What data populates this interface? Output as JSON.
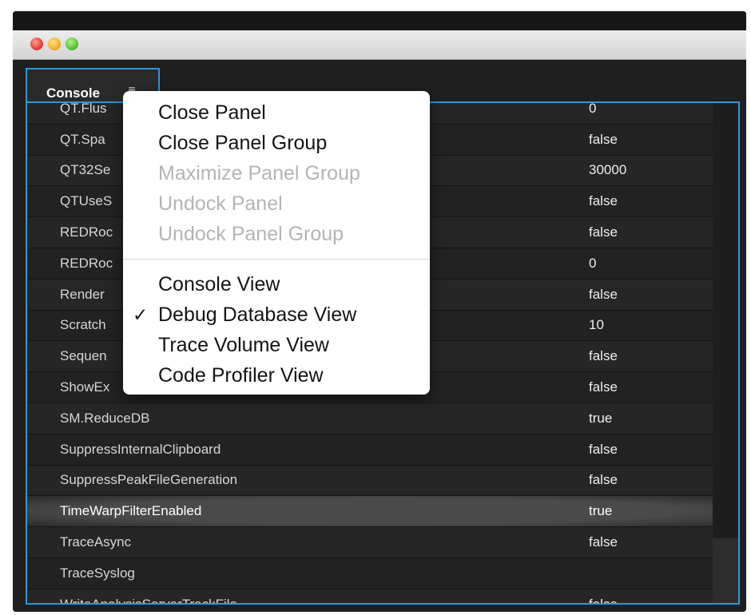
{
  "window": {
    "controls": [
      "close",
      "minimize",
      "maximize"
    ]
  },
  "tab": {
    "label": "Console",
    "menu_icon": "≡"
  },
  "rows": [
    {
      "name": "QT.Flus",
      "value": "0"
    },
    {
      "name": "QT.Spa",
      "value": "false"
    },
    {
      "name": "QT32Se",
      "value": "30000"
    },
    {
      "name": "QTUseS",
      "value": "false"
    },
    {
      "name": "REDRoc",
      "value": "false"
    },
    {
      "name": "REDRoc",
      "value": "0"
    },
    {
      "name": "Render",
      "value": "false"
    },
    {
      "name": "Scratch",
      "value": "10"
    },
    {
      "name": "Sequen",
      "value": "false"
    },
    {
      "name": "ShowEx",
      "value": "false"
    },
    {
      "name": "SM.ReduceDB",
      "value": "true"
    },
    {
      "name": "SuppressInternalClipboard",
      "value": "false"
    },
    {
      "name": "SuppressPeakFileGeneration",
      "value": "false"
    },
    {
      "name": "TimeWarpFilterEnabled",
      "value": "true"
    },
    {
      "name": "TraceAsync",
      "value": "false"
    },
    {
      "name": "TraceSyslog",
      "value": ""
    },
    {
      "name": "WriteAnalysisServerTrackFile",
      "value": "false"
    }
  ],
  "menu": {
    "group1": [
      {
        "label": "Close Panel",
        "enabled": true
      },
      {
        "label": "Close Panel Group",
        "enabled": true
      },
      {
        "label": "Maximize Panel Group",
        "enabled": false
      },
      {
        "label": "Undock Panel",
        "enabled": false
      },
      {
        "label": "Undock Panel Group",
        "enabled": false
      }
    ],
    "group2": [
      {
        "label": "Console View",
        "checked": false
      },
      {
        "label": "Debug Database View",
        "checked": true
      },
      {
        "label": "Trace Volume View",
        "checked": false
      },
      {
        "label": "Code Profiler View",
        "checked": false
      }
    ],
    "check_glyph": "✓"
  },
  "colors": {
    "accent": "#2c9ad6",
    "background": "#1f1f1f",
    "menu_bg": "#ffffff"
  }
}
